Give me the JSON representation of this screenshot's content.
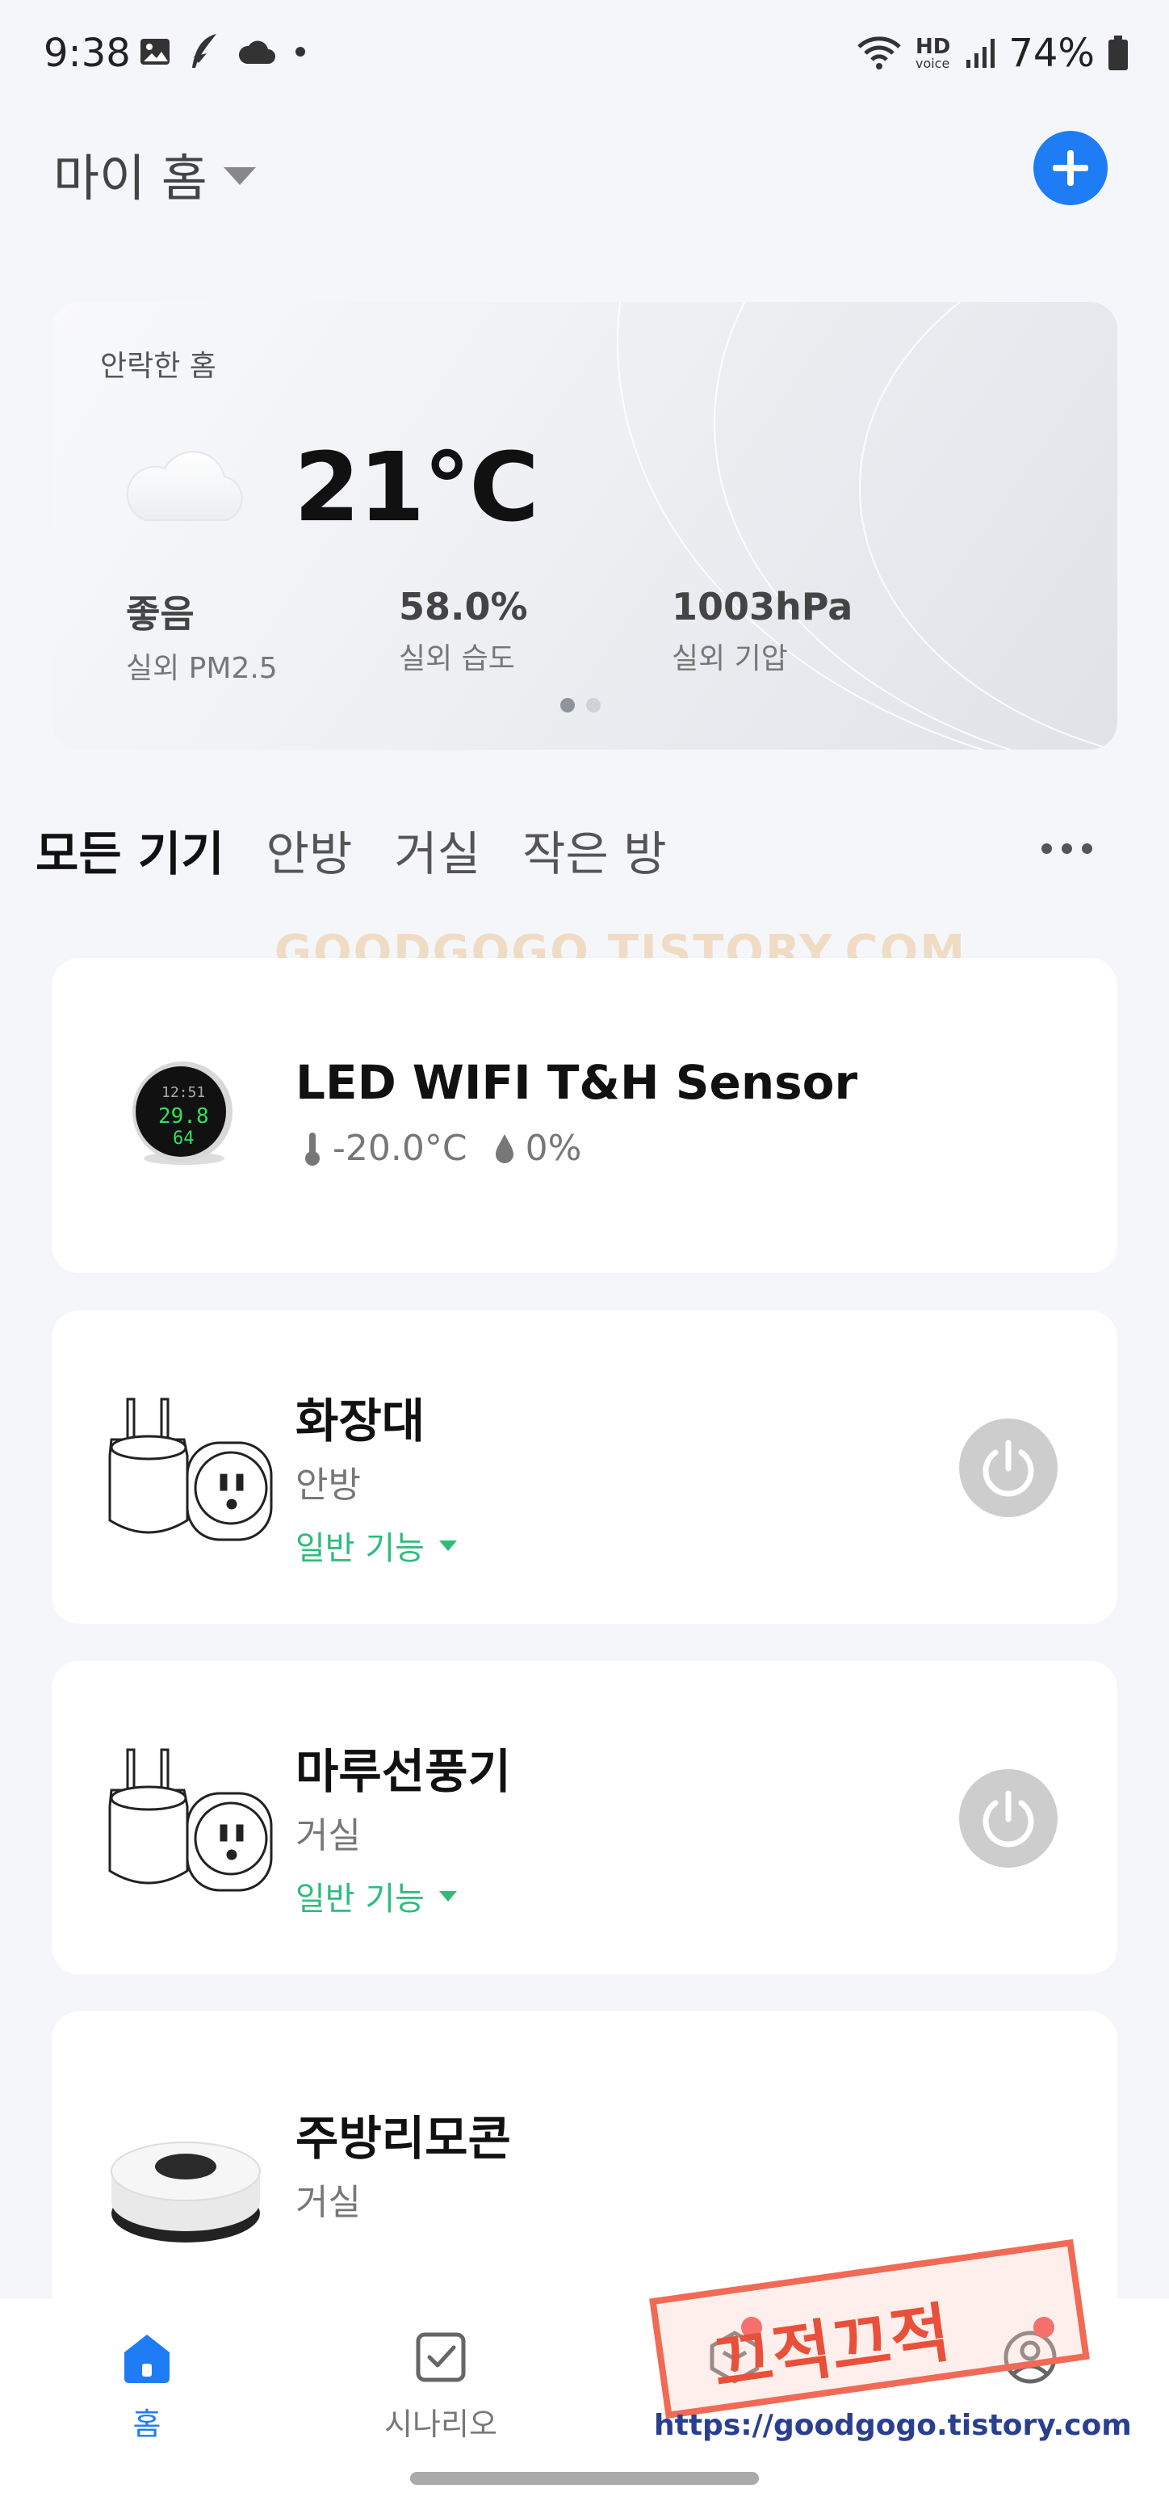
{
  "status_bar": {
    "time": "9:38",
    "hd_label": "HD",
    "voice_label": "voice",
    "battery": "74%"
  },
  "header": {
    "home_name": "마이 홈",
    "add_button": "add"
  },
  "weather": {
    "home_label": "안락한 홈",
    "temperature": "21°C",
    "stats": [
      {
        "value": "좋음",
        "label": "실외 PM2.5"
      },
      {
        "value": "58.0%",
        "label": "실외 습도"
      },
      {
        "value": "1003hPa",
        "label": "실외 기압"
      }
    ]
  },
  "tabs": [
    "모든 기기",
    "안방",
    "거실",
    "작은 방"
  ],
  "watermark": "GOODGOGO.TISTORY.COM",
  "devices": [
    {
      "name": "LED WIFI T&H Sensor",
      "temp": "-20.0°C",
      "humidity": "0%",
      "icon": "thermo-hygrometer-icon"
    },
    {
      "name": "화장대",
      "room": "안방",
      "func": "일반 기능",
      "icon": "smart-plug-icon"
    },
    {
      "name": "마루선풍기",
      "room": "거실",
      "func": "일반 기능",
      "icon": "smart-plug-icon"
    },
    {
      "name": "주방리모콘",
      "room": "거실",
      "icon": "ir-remote-hub-icon"
    }
  ],
  "nav": [
    {
      "label": "홈",
      "icon": "home-icon"
    },
    {
      "label": "시나리오",
      "icon": "checkbox-icon"
    },
    {
      "label": "",
      "icon": "cube-icon"
    },
    {
      "label": "",
      "icon": "profile-icon"
    }
  ],
  "stamp_text": "끄적끄적",
  "url_watermark": "https://goodgogo.tistory.com",
  "colors": {
    "accent": "#1e7cf5",
    "green": "#2dbc7b",
    "power_off": "#cdcdcd"
  }
}
